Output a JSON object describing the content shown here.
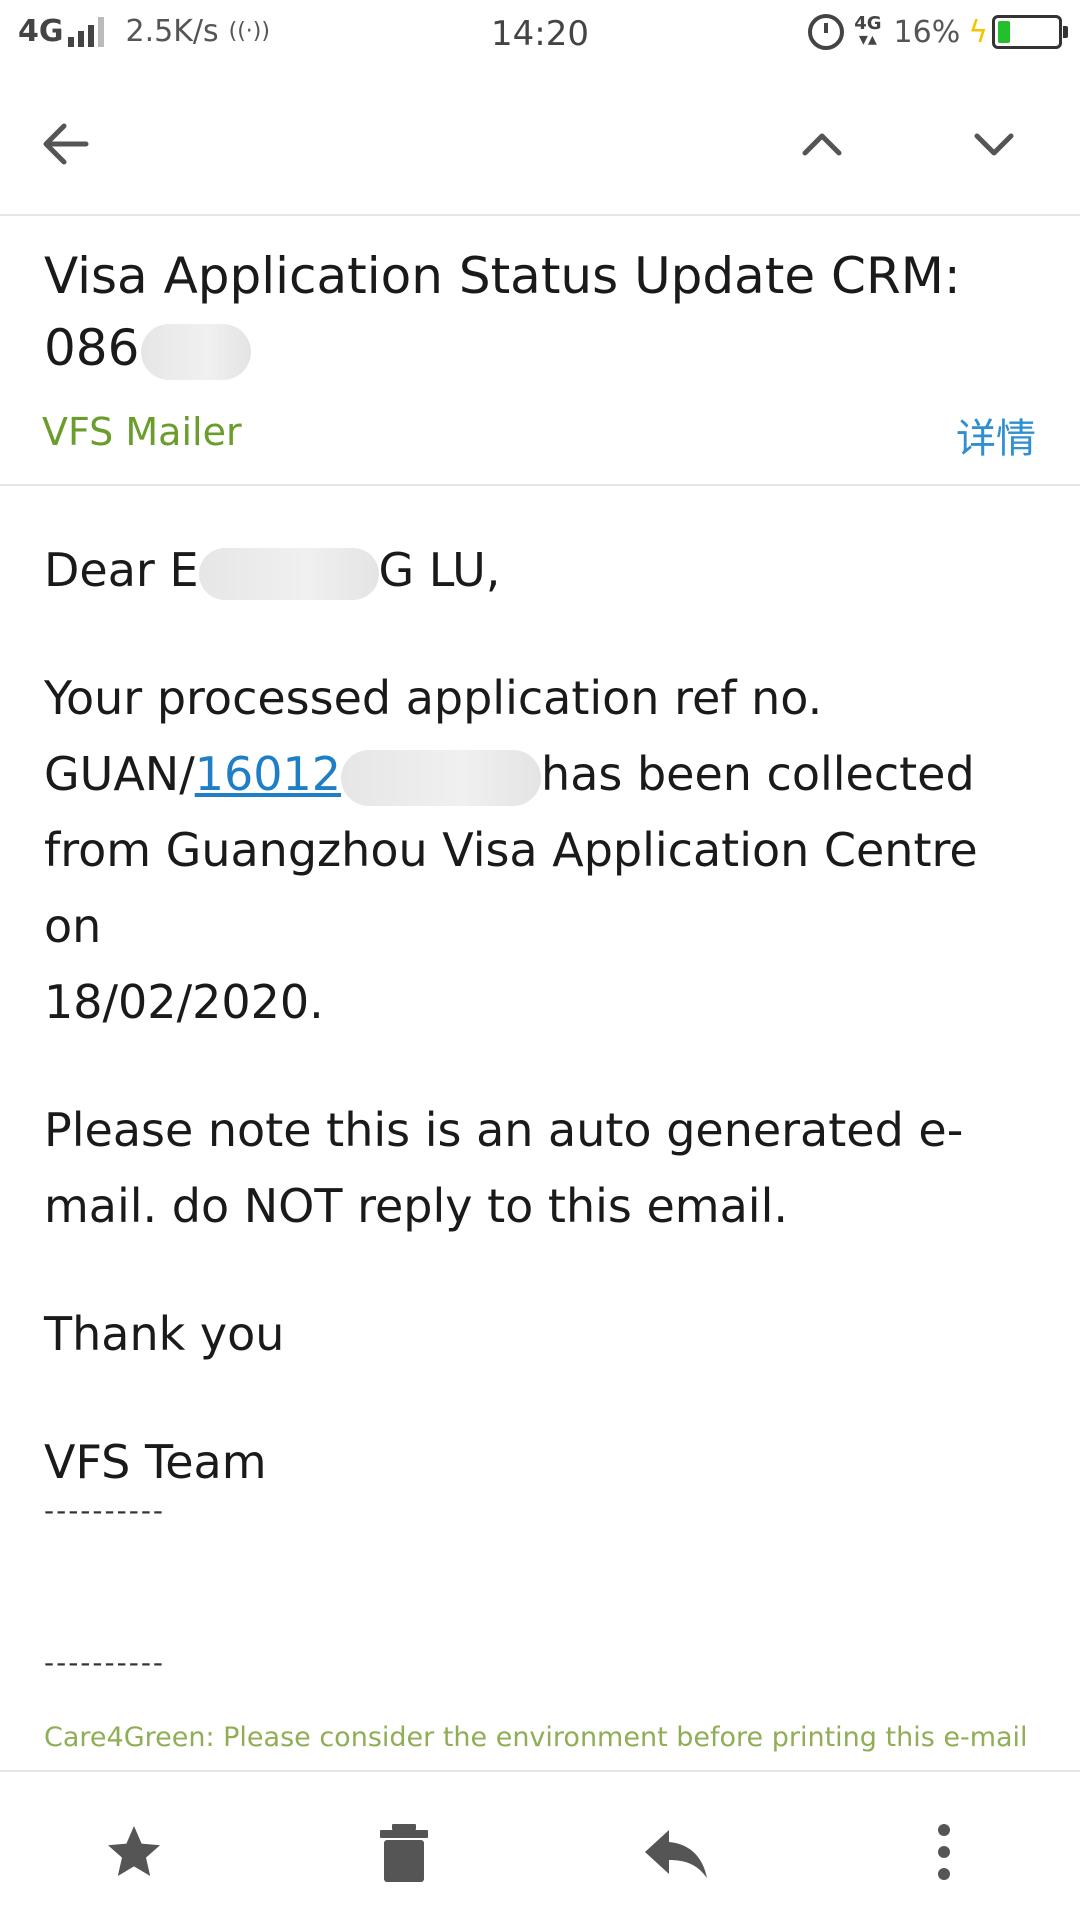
{
  "status_bar": {
    "network": "4G",
    "speed": "2.5K/s",
    "time": "14:20",
    "network_right": "4G",
    "battery_percent": "16%",
    "battery_level": 0.16
  },
  "email": {
    "subject_line1": "Visa Application Status Update CRM:",
    "subject_line2_visible": "086",
    "sender": "VFS Mailer",
    "details_label": "详情",
    "greeting_start": "Dear E",
    "greeting_end": "G LU,",
    "para1_line1": "Your processed  application ref no.",
    "para1_prefix": "GUAN/",
    "para1_link_visible": "16012",
    "para1_after": "has been collected",
    "para1_line3": "from Guangzhou Visa Application Centre on",
    "para1_line4": "18/02/2020.",
    "para2_line1": "Please note this is an auto generated e-",
    "para2_line2": "mail.  do NOT reply to this email.",
    "thanks": "Thank you",
    "signature": "VFS Team",
    "divider1": "----------",
    "divider2": "----------",
    "footer_note": "Care4Green: Please consider the environment before printing this e-mail"
  },
  "colors": {
    "sender": "#6a9d2b",
    "details": "#2f8fd0",
    "link": "#1f7fc6",
    "footer": "#8fae55"
  },
  "icons": {
    "toolbar": [
      "back-arrow-icon",
      "chevron-up-icon",
      "chevron-down-icon"
    ],
    "bottom": [
      "star-icon",
      "trash-icon",
      "reply-icon",
      "more-vertical-icon"
    ]
  }
}
